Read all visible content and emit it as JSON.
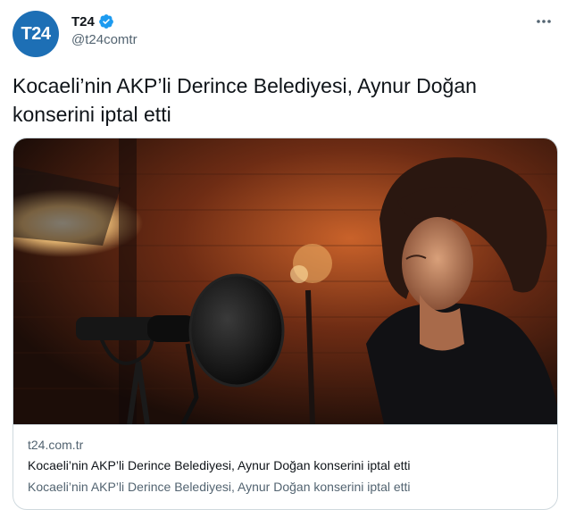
{
  "author": {
    "avatar_text": "T24",
    "display_name": "T24",
    "handle": "@t24comtr",
    "verified": true
  },
  "tweet": {
    "text": "Kocaeli’nin AKP’li Derince Belediyesi, Aynur Doğan konserini iptal etti"
  },
  "card": {
    "domain": "t24.com.tr",
    "title": "Kocaeli’nin AKP’li Derince Belediyesi, Aynur Doğan konserini iptal etti",
    "description": "Kocaeli’nin AKP’li Derince Belediyesi, Aynur Doğan konserini iptal etti"
  },
  "icons": {
    "verified": "verified-badge-icon",
    "more": "more-options-icon"
  },
  "colors": {
    "avatar_bg": "#1d6fb5",
    "verified_blue": "#1d9bf0",
    "secondary_text": "#536471",
    "border": "#cfd9de"
  }
}
